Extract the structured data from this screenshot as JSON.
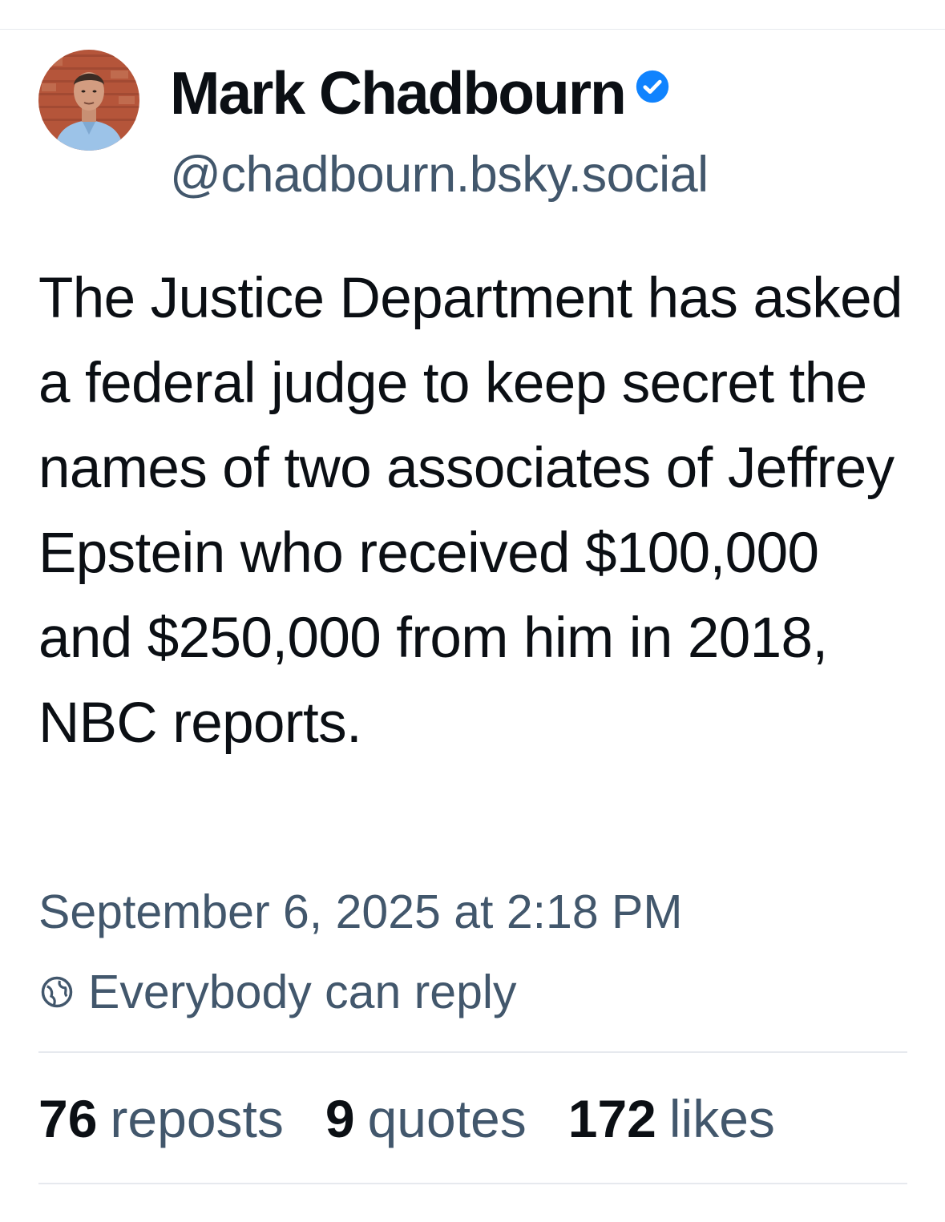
{
  "author": {
    "display_name": "Mark Chadbourn",
    "handle": "@chadbourn.bsky.social",
    "verified": true,
    "avatar_icon": "user-avatar-photo",
    "verified_icon": "verified-check-icon"
  },
  "post": {
    "text": "The Justice Department has asked a federal judge to keep secret the names of two associates of Jeffrey Epstein who received $100,000 and $250,000 from him in 2018, NBC reports.",
    "timestamp": "September 6, 2025 at 2:18 PM",
    "reply_setting": "Everybody can reply",
    "reply_icon": "globe-icon"
  },
  "stats": {
    "reposts_count": "76",
    "reposts_label": "reposts",
    "quotes_count": "9",
    "quotes_label": "quotes",
    "likes_count": "172",
    "likes_label": "likes"
  },
  "colors": {
    "text_primary": "#0b0f14",
    "text_secondary": "#42576c",
    "accent_verified": "#1083fe",
    "divider": "#e6e9ee"
  }
}
